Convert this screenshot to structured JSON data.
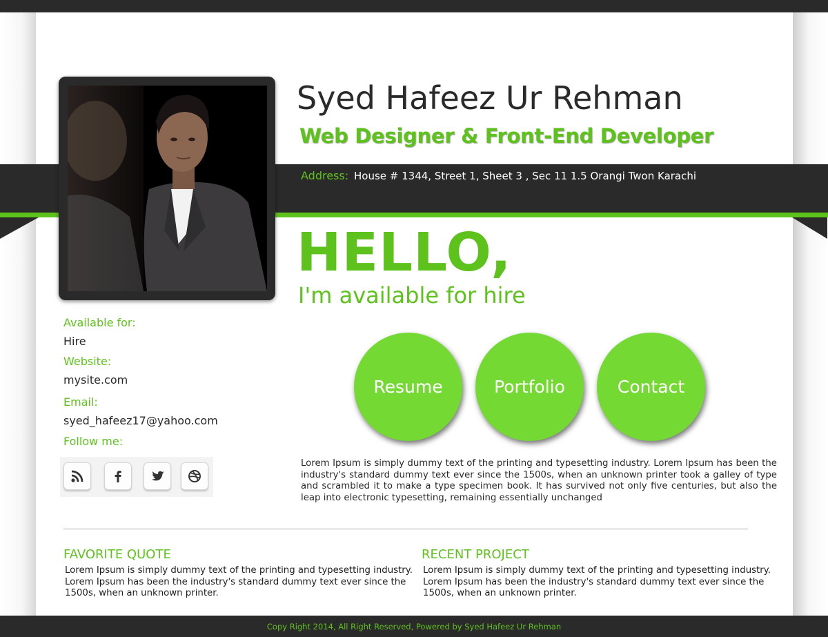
{
  "profile": {
    "name": "Syed Hafeez Ur Rehman",
    "role": "Web Designer & Front-End Developer",
    "address_label": "Address:",
    "address": "House # 1344, Street 1, Sheet 3 , Sec 11 1.5 Orangi Twon Karachi"
  },
  "hero": {
    "hello": "HELLO,",
    "subtitle": "I'm available for hire"
  },
  "info": {
    "available_label": "Available for:",
    "available_value": "Hire",
    "website_label": "Website:",
    "website_value": "mysite.com",
    "email_label": "Email:",
    "email_value": "syed_hafeez17@yahoo.com",
    "follow_label": "Follow me:"
  },
  "social": [
    {
      "icon": "rss-icon"
    },
    {
      "icon": "facebook-icon"
    },
    {
      "icon": "twitter-icon"
    },
    {
      "icon": "dribbble-icon"
    }
  ],
  "nav": {
    "resume": "Resume",
    "portfolio": "Portfolio",
    "contact": "Contact"
  },
  "intro": "Lorem Ipsum is simply dummy text of the printing and typesetting industry. Lorem Ipsum has been the industry's standard dummy text ever since the 1500s, when an unknown printer took a galley of type and scrambled it to make a type specimen book. It has survived not only five centuries, but also the leap into electronic typesetting, remaining essentially unchanged",
  "sections": {
    "quote_title": "FAVORITE QUOTE",
    "quote_body": "Lorem Ipsum is simply dummy text of the printing and typesetting industry. Lorem Ipsum has been the industry's standard dummy text ever since the 1500s, when an unknown printer.",
    "project_title": "RECENT PROJECT",
    "project_body": "Lorem Ipsum is simply dummy text of the printing and typesetting industry. Lorem Ipsum has been the industry's standard dummy text ever since the 1500s, when an unknown printer."
  },
  "footer": "Copy Right 2014, All Right Reserved, Powered by Syed Hafeez Ur Rehman",
  "colors": {
    "accent": "#5ec21c",
    "button": "#74da33",
    "dark": "#2b2a2b"
  }
}
